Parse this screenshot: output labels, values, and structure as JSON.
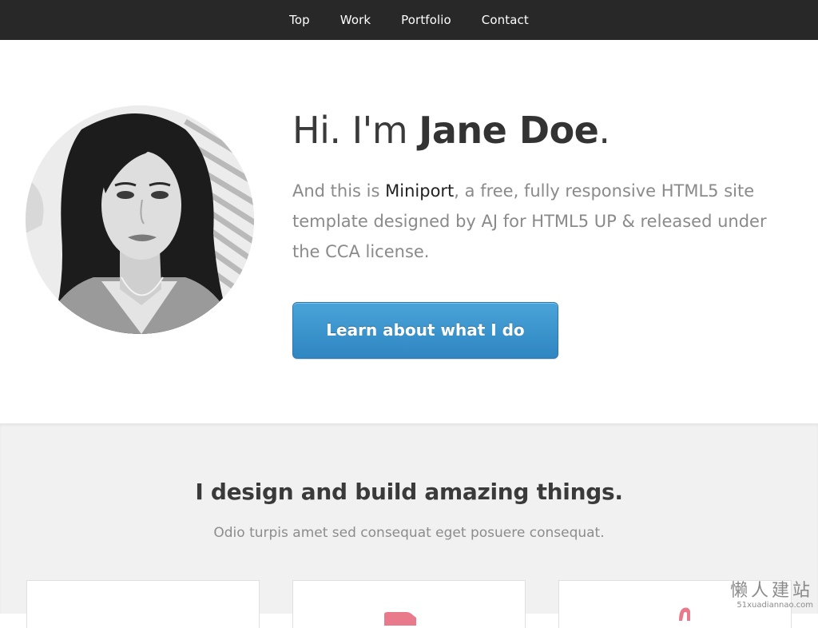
{
  "nav": {
    "items": [
      {
        "label": "Top"
      },
      {
        "label": "Work"
      },
      {
        "label": "Portfolio"
      },
      {
        "label": "Contact"
      }
    ]
  },
  "hero": {
    "greeting": "Hi. I'm ",
    "name": "Jane Doe",
    "period": ".",
    "text_before": "And this is ",
    "brand": "Miniport",
    "text_after": ", a free, fully responsive HTML5 site template designed by AJ for HTML5 UP & released under the CCA license.",
    "cta_label": "Learn about what I do"
  },
  "section2": {
    "title": "I design and build amazing things.",
    "subtitle": "Odio turpis amet sed consequat eget posuere consequat."
  },
  "watermark": {
    "main": "懒人建站",
    "sub": "51xuadiannao.com"
  },
  "colors": {
    "nav_bg": "#282828",
    "accent": "#3a93cd",
    "card_icon": "#e87a8c"
  }
}
